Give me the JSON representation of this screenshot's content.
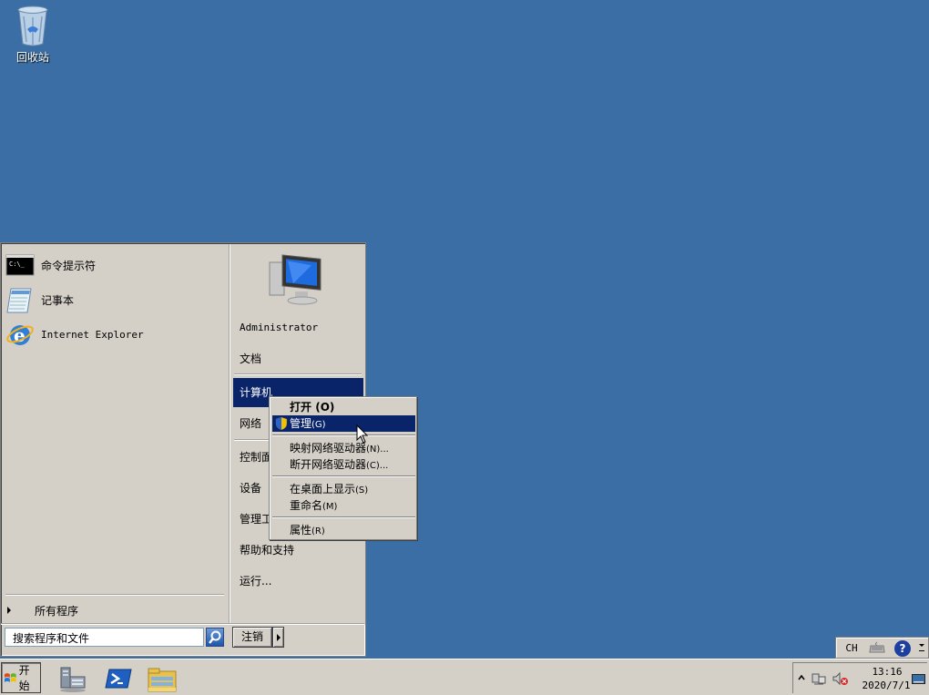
{
  "desktop": {
    "recycle_bin_label": "回收站",
    "background_color": "#3a6ea5"
  },
  "start_menu": {
    "pinned": [
      {
        "label": "命令提示符",
        "icon": "cmd-icon"
      },
      {
        "label": "记事本",
        "icon": "notepad-icon"
      },
      {
        "label": "Internet Explorer",
        "icon": "ie-icon"
      }
    ],
    "all_programs_label": "所有程序",
    "search_placeholder": "搜索程序和文件",
    "logoff_label": "注销",
    "right_items": {
      "user": "Administrator",
      "documents": "文档",
      "computer": "计算机",
      "network": "网络",
      "control_panel": "控制面",
      "devices": "设备",
      "admin_tools": "管理工",
      "help": "帮助和支持",
      "run": "运行..."
    }
  },
  "context_menu": {
    "open_label": "打开",
    "open_accel": "(O)",
    "manage_label": "管理",
    "manage_accel": "(G)",
    "map_drive_label": "映射网络驱动器",
    "map_drive_accel": "(N)...",
    "disconnect_label": "断开网络驱动器",
    "disconnect_accel": "(C)...",
    "show_desktop_label": "在桌面上显示",
    "show_desktop_accel": "(S)",
    "rename_label": "重命名",
    "rename_accel": "(M)",
    "properties_label": "属性",
    "properties_accel": "(R)"
  },
  "language_bar": {
    "lang": "CH",
    "help": "?"
  },
  "taskbar": {
    "start_label": "开始",
    "apps": [
      "server-manager-icon",
      "powershell-icon",
      "explorer-icon"
    ],
    "clock_time": "13:16",
    "clock_date": "2020/7/1"
  },
  "colors": {
    "highlight": "#0a246a",
    "menu_bg": "#d4d0c8"
  }
}
